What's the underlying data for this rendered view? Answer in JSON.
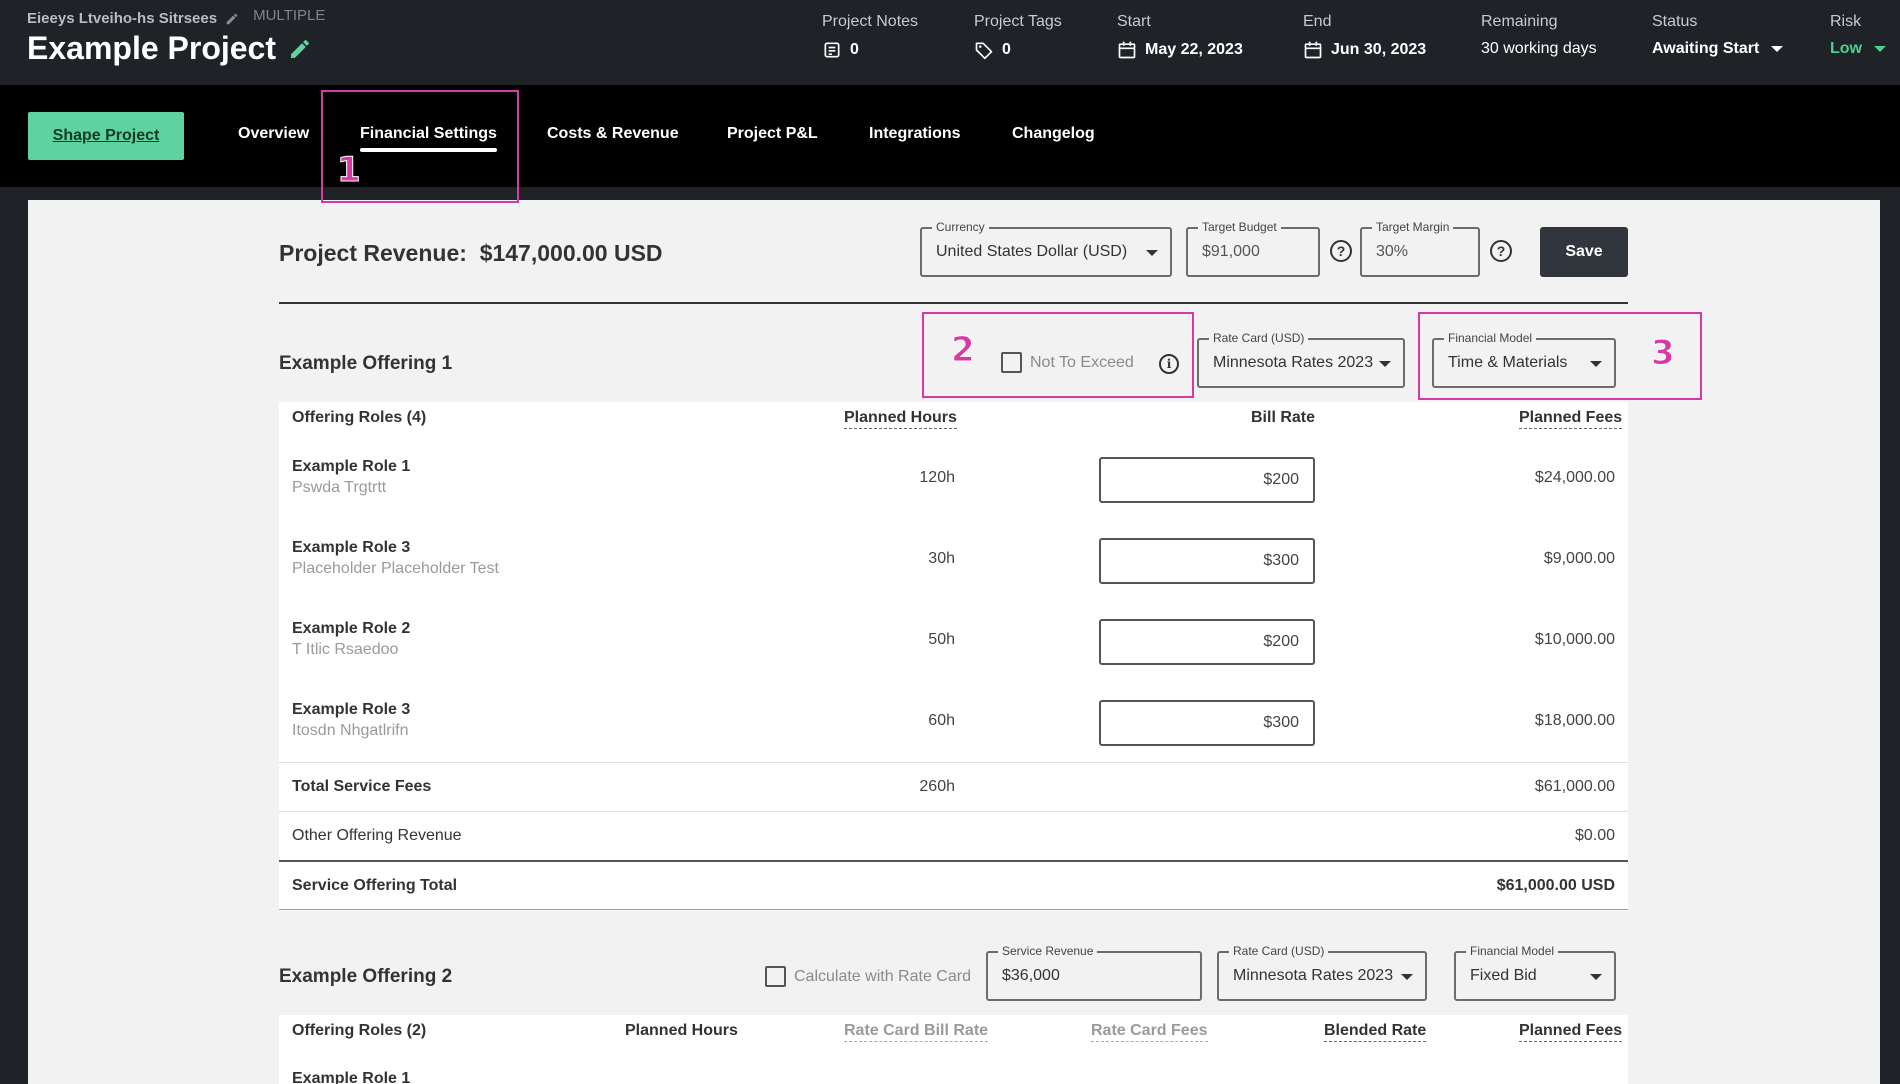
{
  "header": {
    "breadcrumb": "Eieeys Ltveiho-hs Sitrsees",
    "multiple": "MULTIPLE",
    "project_title": "Example Project",
    "project_notes": {
      "label": "Project Notes",
      "value": "0"
    },
    "project_tags": {
      "label": "Project Tags",
      "value": "0"
    },
    "start": {
      "label": "Start",
      "value": "May 22, 2023"
    },
    "end": {
      "label": "End",
      "value": "Jun 30, 2023"
    },
    "remaining": {
      "label": "Remaining",
      "value": "30 working days"
    },
    "status": {
      "label": "Status",
      "value": "Awaiting Start"
    },
    "risk": {
      "label": "Risk",
      "value": "Low",
      "color": "#4ccf8f"
    }
  },
  "nav": {
    "shape_button": "Shape Project",
    "tabs": [
      "Overview",
      "Financial Settings",
      "Costs & Revenue",
      "Project P&L",
      "Integrations",
      "Changelog"
    ],
    "active_tab": "Financial Settings"
  },
  "annotations": [
    "1",
    "2",
    "3"
  ],
  "revenue": {
    "label": "Project Revenue:",
    "value": "$147,000.00 USD",
    "currency": {
      "label": "Currency",
      "value": "United States Dollar (USD)"
    },
    "target_budget": {
      "label": "Target Budget",
      "value": "$91,000"
    },
    "target_margin": {
      "label": "Target Margin",
      "value": "30%"
    },
    "save_label": "Save"
  },
  "offering1": {
    "title": "Example Offering 1",
    "not_to_exceed": "Not To Exceed",
    "rate_card": {
      "label": "Rate Card (USD)",
      "value": "Minnesota Rates 2023"
    },
    "financial_model": {
      "label": "Financial Model",
      "value": "Time & Materials"
    },
    "headers": {
      "roles": "Offering Roles (4)",
      "hours": "Planned Hours",
      "bill_rate": "Bill Rate",
      "fees": "Planned Fees"
    },
    "rows": [
      {
        "role": "Example Role 1",
        "person": "Pswda Trgtrtt",
        "hours": "120h",
        "rate": "$200",
        "fees": "$24,000.00"
      },
      {
        "role": "Example Role 3",
        "person": "Placeholder Placeholder Test",
        "hours": "30h",
        "rate": "$300",
        "fees": "$9,000.00"
      },
      {
        "role": "Example Role 2",
        "person": "T Itlic Rsaedoo",
        "hours": "50h",
        "rate": "$200",
        "fees": "$10,000.00"
      },
      {
        "role": "Example Role 3",
        "person": "Itosdn Nhgatlrifn",
        "hours": "60h",
        "rate": "$300",
        "fees": "$18,000.00"
      }
    ],
    "total_service_fees": {
      "label": "Total Service Fees",
      "hours": "260h",
      "value": "$61,000.00"
    },
    "other_revenue": {
      "label": "Other Offering Revenue",
      "value": "$0.00"
    },
    "offering_total": {
      "label": "Service Offering Total",
      "value": "$61,000.00 USD"
    }
  },
  "offering2": {
    "title": "Example Offering 2",
    "calc_rate_card": "Calculate with Rate Card",
    "service_revenue": {
      "label": "Service Revenue",
      "value": "$36,000"
    },
    "rate_card": {
      "label": "Rate Card (USD)",
      "value": "Minnesota Rates 2023"
    },
    "financial_model": {
      "label": "Financial Model",
      "value": "Fixed Bid"
    },
    "headers": {
      "roles": "Offering Roles (2)",
      "hours": "Planned Hours",
      "rc_bill_rate": "Rate Card Bill Rate",
      "rc_fees": "Rate Card Fees",
      "blended": "Blended Rate",
      "fees": "Planned Fees"
    },
    "first_row": "Example Role 1"
  }
}
